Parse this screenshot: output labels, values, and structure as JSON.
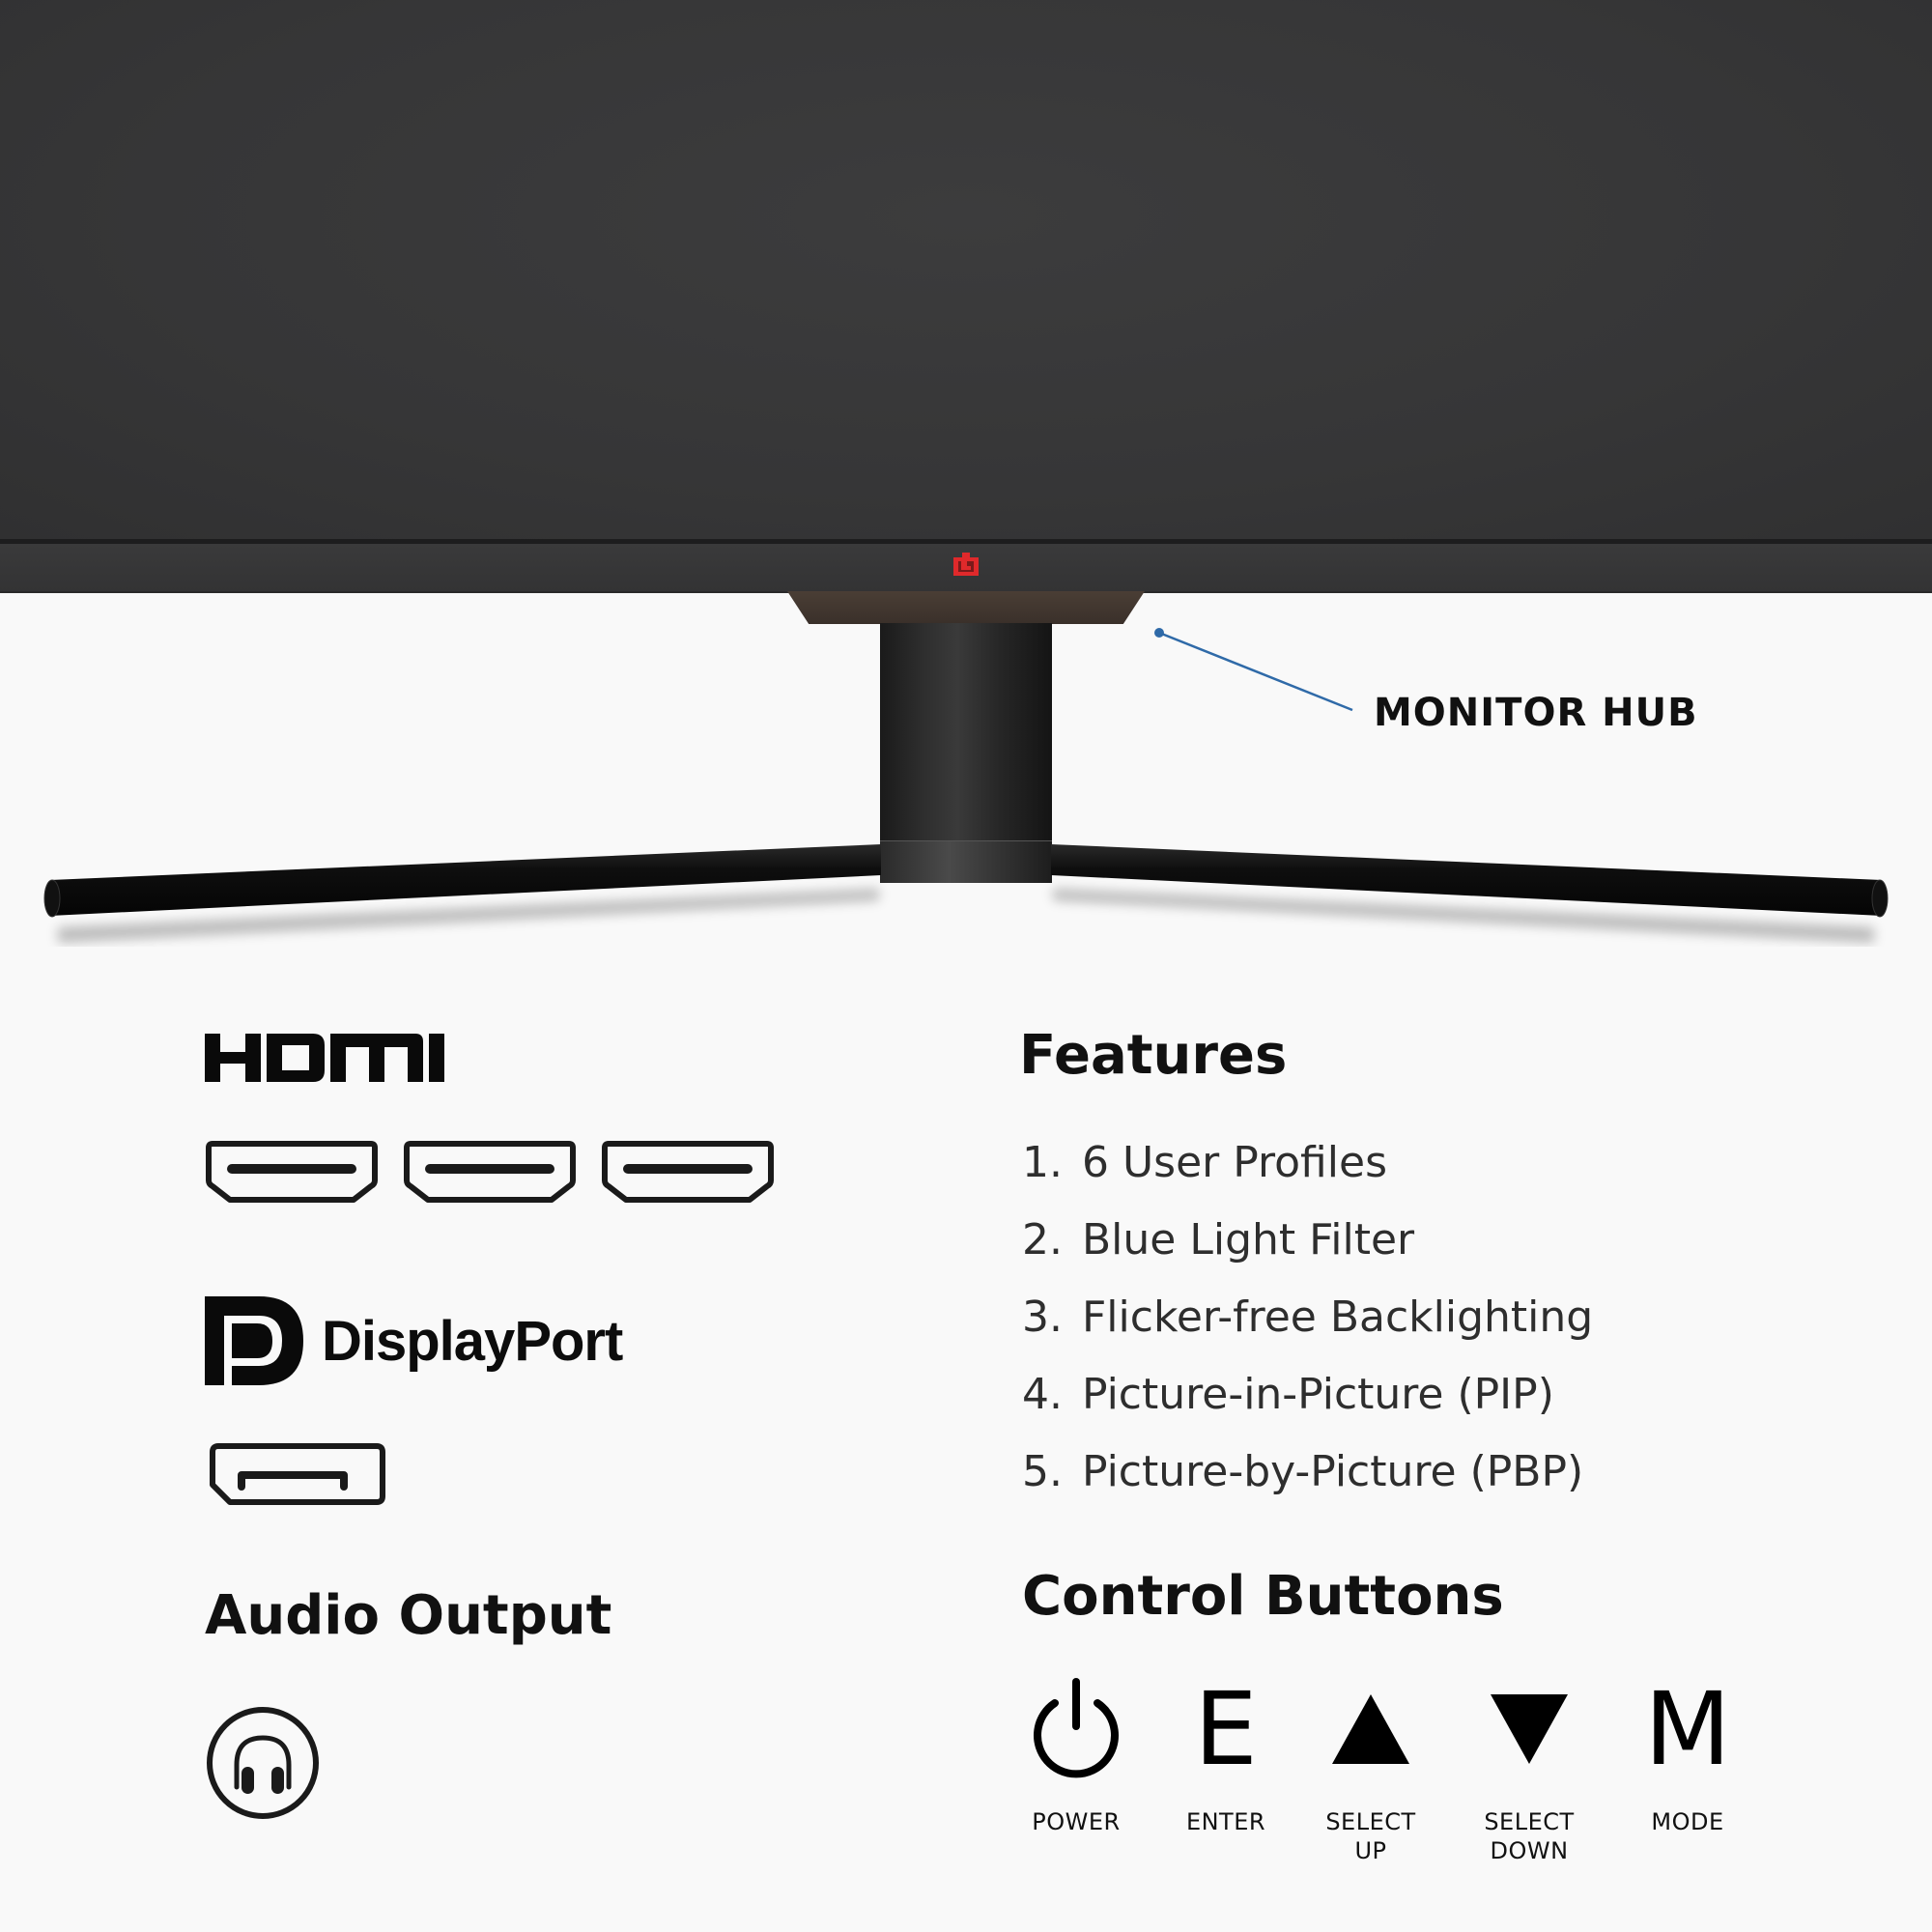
{
  "callout": {
    "label": "MONITOR HUB",
    "line_color": "#2f6aa8"
  },
  "colors": {
    "brand_logo": "#e0292b",
    "background": "#f9f9f9",
    "monitor": "#363637"
  },
  "connectivity": {
    "hdmi": {
      "logo_text": "HDMI",
      "port_count": 3,
      "ports": [
        {
          "icon": "hdmi-port-icon"
        },
        {
          "icon": "hdmi-port-icon"
        },
        {
          "icon": "hdmi-port-icon"
        }
      ]
    },
    "displayport": {
      "logo_text": "DisplayPort",
      "port_count": 1,
      "ports": [
        {
          "icon": "displayport-port-icon"
        }
      ]
    },
    "audio": {
      "title": "Audio Output",
      "icon": "headphones-icon"
    }
  },
  "features": {
    "title": "Features",
    "items": [
      {
        "number": "1.",
        "text": "6 User Profiles"
      },
      {
        "number": "2.",
        "text": "Blue Light Filter"
      },
      {
        "number": "3.",
        "text": "Flicker-free Backlighting"
      },
      {
        "number": "4.",
        "text": "Picture-in-Picture (PIP)"
      },
      {
        "number": "5.",
        "text": "Picture-by-Picture (PBP)"
      }
    ]
  },
  "controls": {
    "title": "Control Buttons",
    "buttons": [
      {
        "icon": "power-icon",
        "glyph": "",
        "label_line1": "POWER",
        "label_line2": ""
      },
      {
        "icon": "enter-icon",
        "glyph": "E",
        "label_line1": "ENTER",
        "label_line2": ""
      },
      {
        "icon": "triangle-up-icon",
        "glyph": "",
        "label_line1": "SELECT",
        "label_line2": "UP"
      },
      {
        "icon": "triangle-down-icon",
        "glyph": "",
        "label_line1": "SELECT",
        "label_line2": "DOWN"
      },
      {
        "icon": "mode-icon",
        "glyph": "M",
        "label_line1": "MODE",
        "label_line2": ""
      }
    ]
  }
}
